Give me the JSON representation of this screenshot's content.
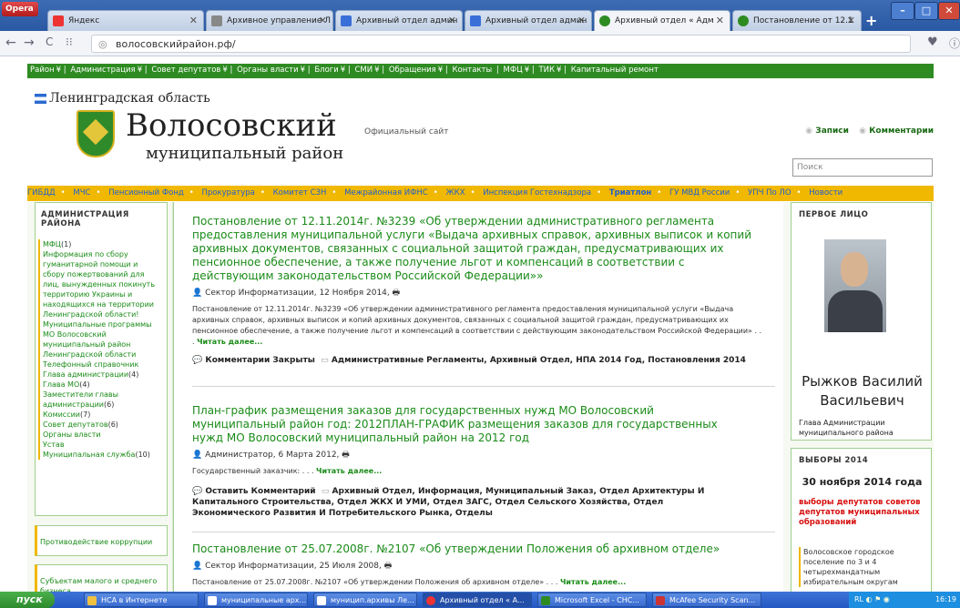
{
  "browser": {
    "menu_label": "Opera",
    "new_tab": "+",
    "tabs": [
      {
        "title": "Яндекс",
        "active": false
      },
      {
        "title": "Архивное управление Л",
        "active": false
      },
      {
        "title": "Архивный отдел админ",
        "active": false
      },
      {
        "title": "Архивный отдел админ",
        "active": false
      },
      {
        "title": "Архивный отдел « Адм",
        "active": true
      },
      {
        "title": "Постановление от 12.1",
        "active": false
      }
    ],
    "url": "волосовскийрайон.рф/"
  },
  "topnav": [
    "Район",
    "Администрация",
    "Совет депутатов",
    "Органы власти",
    "Блоги",
    "СМИ",
    "Обращения",
    "Контакты",
    "МФЦ",
    "ТИК",
    "Капитальный ремонт"
  ],
  "header": {
    "region": "Ленинградская область",
    "title1": "Волосовский",
    "title2": "муниципальный район",
    "official": "Официальный сайт",
    "feed_posts": "Записи",
    "feed_comments": "Комментарии",
    "search_placeholder": "Поиск"
  },
  "yellownav": [
    "ГИБДД",
    "МЧС",
    "Пенсионный Фонд",
    "Прокуратура",
    "Комитет СЗН",
    "Межрайонная ИФНС",
    "ЖКХ",
    "Инспекция Гостехнадзора",
    "Триатлон",
    "ГУ МВД России",
    "УПЧ По ЛО",
    "Новости"
  ],
  "left": {
    "heading": "АДМИНИСТРАЦИЯ РАЙОНА",
    "items": [
      {
        "label": "МФЦ",
        "count": "(1)"
      },
      {
        "label": "Информация по сбору гуманитарной помощи и сбору пожертвований для лиц, вынужденных покинуть территорию Украины и находящихся на территории Ленинградской области!",
        "count": ""
      },
      {
        "label": "Муниципальные программы МО Волосовский муниципальный район Ленинградской области",
        "count": ""
      },
      {
        "label": "Телефонный справочник",
        "count": ""
      },
      {
        "label": "Глава администрации",
        "count": "(4)"
      },
      {
        "label": "Глава МО",
        "count": "(4)"
      },
      {
        "label": "Заместители главы администрации",
        "count": "(6)"
      },
      {
        "label": "Комиссии",
        "count": "(7)"
      },
      {
        "label": "Совет депутатов",
        "count": "(6)"
      },
      {
        "label": "Органы власти",
        "count": ""
      },
      {
        "label": "Устав",
        "count": ""
      },
      {
        "label": "Муниципальная служба",
        "count": "(10)"
      }
    ],
    "box2": "Противодействие коррупции",
    "box3": "Субъектам малого и среднего бизнеса"
  },
  "posts": [
    {
      "title": "Постановление от 12.11.2014г. №3239 «Об утверждении административного регламента предоставления муниципальной услуги «Выдача архивных справок, архивных выписок и копий архивных документов, связанных с социальной защитой граждан, предусматривающих их пенсионное обеспечение, а также получение льгот и компенсаций в соответствии с действующим законодательством Российской Федерации»»",
      "meta": "Сектор Информатизации, 12 Ноября 2014,",
      "body": "Постановление от 12.11.2014г. №3239 «Об утверждении административного регламента предоставления муниципальной услуги «Выдача архивных справок, архивных выписок и копий архивных документов, связанных с социальной защитой граждан, предусматривающих их пенсионное обеспечение, а также получение льгот и компенсаций в соответствии с действующим законодательством Российской Федерации» . . .",
      "more": "Читать далее...",
      "comments": "Комментарии Закрыты",
      "tags": "Административные Регламенты, Архивный Отдел, НПА 2014 Год, Постановления 2014"
    },
    {
      "title": "План-график размещения заказов для государственных нужд МО Волосовский муниципальный район год: 2012ПЛАН-ГРАФИК размещения заказов для государственных нужд МО Волосовский муниципальный район на 2012 год",
      "meta": "Администратор, 6 Марта 2012,",
      "body": "Государственный заказчик: . . .",
      "more": "Читать далее...",
      "comments": "Оставить Комментарий",
      "tags": "Архивный Отдел, Информация, Муниципальный Заказ, Отдел Архитектуры И Капитального Строительства, Отдел ЖКХ И УМИ, Отдел ЗАГС, Отдел Сельского Хозяйства, Отдел Экономического Развития И Потребительского Рынка, Отделы"
    },
    {
      "title": "Постановление от 25.07.2008г. №2107 «Об утверждении Положения об архивном отделе»",
      "meta": "Сектор Информатизации, 25 Июля 2008,",
      "body": "Постановление от 25.07.2008г. №2107 «Об утверждении Положения об архивном отделе» . . .",
      "more": "Читать далее..."
    }
  ],
  "right": {
    "heading1": "ПЕРВОЕ ЛИЦО",
    "person": "Рыжков Василий Васильевич",
    "role": "Глава Администрации муниципального района",
    "heading2": "ВЫБОРЫ 2014",
    "date": "30 ноября 2014 года",
    "red": "выборы депутатов советов депутатов муниципальных образований",
    "note": "Волосовское городское поселение по 3 и 4 четырехмандатным избирательным округам"
  },
  "taskbar": {
    "start": "пуск",
    "tasks": [
      "НСА в Интернете",
      "муниципальные арх...",
      "муницип.архивы Ле...",
      "Архивный отдел « А...",
      "Microsoft Excel - СНС...",
      "McAfee Security Scan..."
    ],
    "tray": "RL",
    "time": "16:19"
  }
}
